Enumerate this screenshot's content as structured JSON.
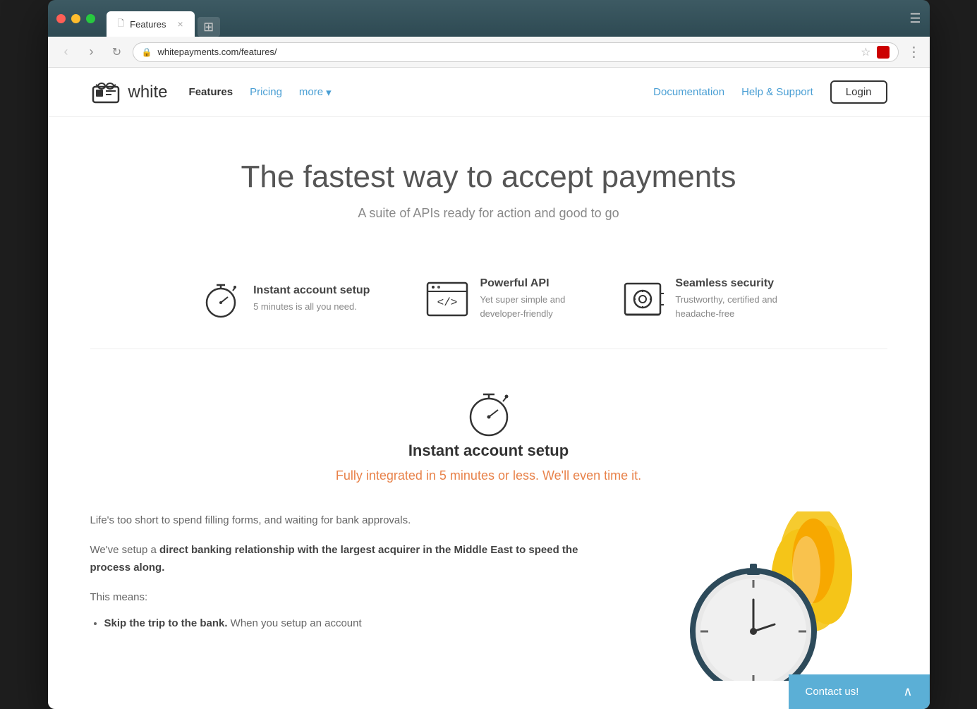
{
  "browser": {
    "tab_label": "Features",
    "tab_url": "whitepayments.com/features/",
    "new_tab_symbol": "⊞"
  },
  "nav": {
    "logo_text": "white",
    "links": [
      {
        "label": "Features",
        "active": true,
        "blue": false
      },
      {
        "label": "Pricing",
        "active": false,
        "blue": true
      },
      {
        "label": "more",
        "active": false,
        "blue": true
      }
    ],
    "right_links": [
      {
        "label": "Documentation"
      },
      {
        "label": "Help & Support"
      }
    ],
    "login_label": "Login"
  },
  "hero": {
    "title": "The fastest way to accept payments",
    "subtitle": "A suite of APIs ready for action and good to go"
  },
  "features": [
    {
      "id": "instant-setup",
      "title": "Instant account setup",
      "description": "5 minutes is all you need."
    },
    {
      "id": "powerful-api",
      "title": "Powerful API",
      "description": "Yet super simple and\ndeveloper-friendly"
    },
    {
      "id": "seamless-security",
      "title": "Seamless security",
      "description": "Trustworthy, certified and\nheadache-free"
    }
  ],
  "detail": {
    "title": "Instant account setup",
    "subtitle": "Fully integrated in 5 minutes or less. We'll even time it.",
    "body_p1": "Life's too short to spend filling forms, and waiting for bank approvals.",
    "body_p2_pre": "We've setup a ",
    "body_p2_bold": "direct banking relationship with the largest acquirer in the Middle East to speed the process along.",
    "body_p3": "This means:",
    "bullet1_bold": "Skip the trip to the bank.",
    "bullet1_text": " When you setup an account"
  },
  "contact": {
    "label": "Contact us!"
  }
}
